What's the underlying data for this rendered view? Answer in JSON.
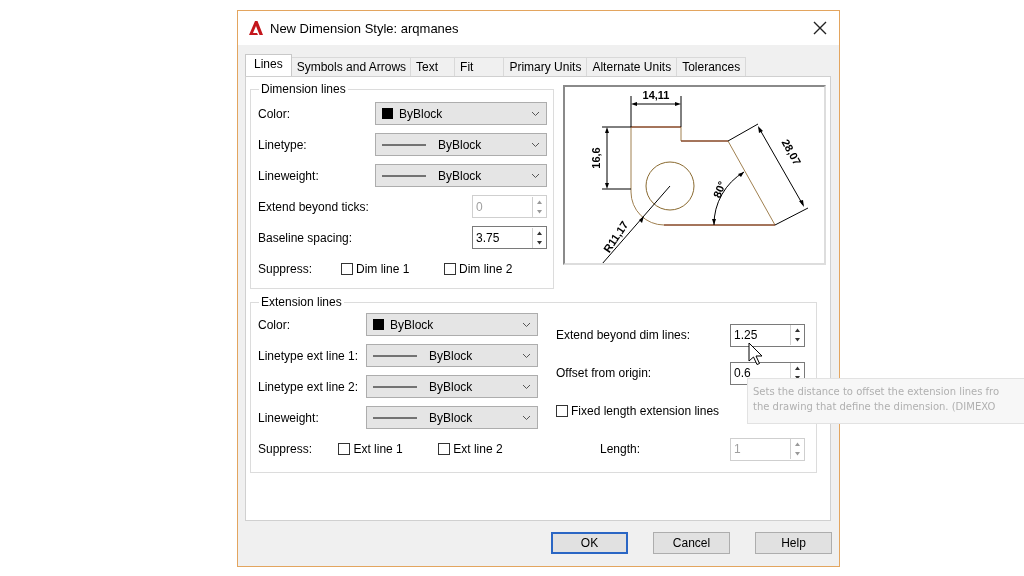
{
  "window": {
    "title": "New Dimension Style: arqmanes"
  },
  "tabs": [
    {
      "label": "Lines",
      "selected": true
    },
    {
      "label": "Symbols and Arrows",
      "selected": false
    },
    {
      "label": "Text",
      "selected": false
    },
    {
      "label": "Fit",
      "selected": false
    },
    {
      "label": "Primary Units",
      "selected": false
    },
    {
      "label": "Alternate Units",
      "selected": false
    },
    {
      "label": "Tolerances",
      "selected": false
    }
  ],
  "dimension_lines": {
    "title": "Dimension lines",
    "fields": [
      {
        "kind": "color-dropdown",
        "label": "Color:",
        "value": "ByBlock"
      },
      {
        "kind": "line-dropdown",
        "label": "Linetype:",
        "value": "ByBlock"
      },
      {
        "kind": "line-dropdown",
        "label": "Lineweight:",
        "value": "ByBlock"
      },
      {
        "kind": "spinner",
        "label": "Extend beyond ticks:",
        "value": "0",
        "disabled": true
      },
      {
        "kind": "spinner",
        "label": "Baseline spacing:",
        "value": "3.75",
        "disabled": false
      }
    ],
    "suppress": {
      "label": "Suppress:",
      "options": [
        {
          "label": "Dim line 1",
          "checked": false
        },
        {
          "label": "Dim line 2",
          "checked": false
        }
      ]
    }
  },
  "preview": {
    "labels": [
      "14,11",
      "16,6",
      "28,07",
      "80°",
      "R11,17"
    ]
  },
  "extension_lines": {
    "title": "Extension lines",
    "fields": [
      {
        "kind": "color-dropdown",
        "label": "Color:",
        "value": "ByBlock"
      },
      {
        "kind": "line-dropdown",
        "label": "Linetype ext line 1:",
        "value": "ByBlock"
      },
      {
        "kind": "line-dropdown",
        "label": "Linetype ext line 2:",
        "value": "ByBlock"
      },
      {
        "kind": "line-dropdown",
        "label": "Lineweight:",
        "value": "ByBlock"
      }
    ],
    "suppress": {
      "label": "Suppress:",
      "options": [
        {
          "label": "Ext line 1",
          "checked": false
        },
        {
          "label": "Ext line 2",
          "checked": false
        }
      ]
    },
    "right_fields": [
      {
        "kind": "spinner",
        "label": "Extend beyond dim lines:",
        "value": "1.25",
        "disabled": false
      },
      {
        "kind": "spinner",
        "label": "Offset from origin:",
        "value": "0.6",
        "disabled": false
      },
      {
        "kind": "checkbox",
        "label": "Fixed length extension lines",
        "checked": false
      },
      {
        "kind": "spinner",
        "label": "Length:",
        "value": "1",
        "disabled": true
      }
    ]
  },
  "tooltip": {
    "lines": [
      "Sets the distance to offset the extension lines fro",
      "the drawing that define the dimension. (DIMEXO"
    ]
  },
  "buttons": [
    {
      "label": "OK",
      "default": true
    },
    {
      "label": "Cancel",
      "default": false
    },
    {
      "label": "Help",
      "default": false
    }
  ]
}
